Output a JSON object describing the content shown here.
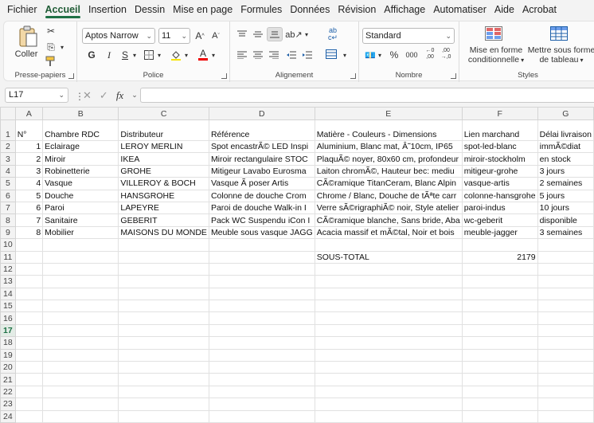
{
  "menu": [
    "Fichier",
    "Accueil",
    "Insertion",
    "Dessin",
    "Mise en page",
    "Formules",
    "Données",
    "Révision",
    "Affichage",
    "Automatiser",
    "Aide",
    "Acrobat"
  ],
  "active_menu_index": 1,
  "ribbon": {
    "clipboard": {
      "paste_label": "Coller",
      "group_label": "Presse-papiers"
    },
    "font": {
      "font_name": "Aptos Narrow",
      "font_size": "11",
      "group_label": "Police",
      "bold": "G",
      "italic": "I",
      "underline": "S"
    },
    "alignment": {
      "group_label": "Alignement"
    },
    "number": {
      "format": "Standard",
      "group_label": "Nombre"
    },
    "styles": {
      "conditional_label_1": "Mise en forme",
      "conditional_label_2": "conditionnelle",
      "table_label_1": "Mettre sous forme",
      "table_label_2": "de tableau",
      "group_label": "Styles"
    }
  },
  "formula_bar": {
    "name_box": "L17",
    "fx": "fx",
    "formula": ""
  },
  "columns": [
    "A",
    "B",
    "C",
    "D",
    "E",
    "F",
    "G"
  ],
  "rows": [
    {
      "n": "1",
      "cells": [
        "N°",
        "Chambre RDC",
        "Distributeur",
        "Référence",
        "Matière - Couleurs - Dimensions",
        "Lien marchand",
        "Délai livraison"
      ]
    },
    {
      "n": "2",
      "cells": [
        "1",
        "Eclairage",
        "LEROY MERLIN",
        "Spot encastrÃ© LED Inspi",
        "Aluminium, Blanc mat, Â˜10cm, IP65",
        "spot-led-blanc",
        "immÃ©diat"
      ]
    },
    {
      "n": "3",
      "cells": [
        "2",
        "Miroir",
        "IKEA",
        "Miroir rectangulaire STOC",
        "PlaquÃ© noyer, 80x60 cm, profondeur",
        "miroir-stockholm",
        "en stock"
      ]
    },
    {
      "n": "4",
      "cells": [
        "3",
        "Robinetterie",
        "GROHE",
        "Mitigeur Lavabo Eurosma",
        "Laiton chromÃ©, Hauteur bec: mediu",
        "mitigeur-grohe",
        "3 jours"
      ]
    },
    {
      "n": "5",
      "cells": [
        "4",
        "Vasque",
        "VILLEROY & BOCH",
        "Vasque Ã  poser Artis",
        "CÃ©ramique TitanCeram, Blanc Alpin",
        "vasque-artis",
        "2 semaines"
      ]
    },
    {
      "n": "6",
      "cells": [
        "5",
        "Douche",
        "HANSGROHE",
        "Colonne de douche Crom",
        "Chrome / Blanc, Douche de tÃªte carr",
        "colonne-hansgrohe",
        "5 jours"
      ]
    },
    {
      "n": "7",
      "cells": [
        "6",
        "Paroi",
        "LAPEYRE",
        "Paroi de douche Walk-in I",
        "Verre sÃ©rigraphiÃ© noir, Style atelier",
        "paroi-indus",
        "10 jours"
      ]
    },
    {
      "n": "8",
      "cells": [
        "7",
        "Sanitaire",
        "GEBERIT",
        "Pack WC Suspendu iCon I",
        "CÃ©ramique blanche, Sans bride, Aba",
        "wc-geberit",
        "disponible"
      ]
    },
    {
      "n": "9",
      "cells": [
        "8",
        "Mobilier",
        "MAISONS DU MONDE",
        "Meuble sous vasque JAGG",
        "Acacia massif et mÃ©tal, Noir et bois",
        "meuble-jagger",
        "3 semaines"
      ]
    },
    {
      "n": "10",
      "cells": [
        "",
        "",
        "",
        "",
        "",
        "",
        ""
      ]
    },
    {
      "n": "11",
      "cells": [
        "",
        "",
        "",
        "",
        "SOUS-TOTAL",
        "2179",
        ""
      ]
    },
    {
      "n": "12",
      "cells": [
        "",
        "",
        "",
        "",
        "",
        "",
        ""
      ]
    },
    {
      "n": "13",
      "cells": [
        "",
        "",
        "",
        "",
        "",
        "",
        ""
      ]
    },
    {
      "n": "14",
      "cells": [
        "",
        "",
        "",
        "",
        "",
        "",
        ""
      ]
    },
    {
      "n": "15",
      "cells": [
        "",
        "",
        "",
        "",
        "",
        "",
        ""
      ]
    },
    {
      "n": "16",
      "cells": [
        "",
        "",
        "",
        "",
        "",
        "",
        ""
      ]
    },
    {
      "n": "17",
      "cells": [
        "",
        "",
        "",
        "",
        "",
        "",
        ""
      ]
    },
    {
      "n": "18",
      "cells": [
        "",
        "",
        "",
        "",
        "",
        "",
        ""
      ]
    },
    {
      "n": "19",
      "cells": [
        "",
        "",
        "",
        "",
        "",
        "",
        ""
      ]
    },
    {
      "n": "20",
      "cells": [
        "",
        "",
        "",
        "",
        "",
        "",
        ""
      ]
    },
    {
      "n": "21",
      "cells": [
        "",
        "",
        "",
        "",
        "",
        "",
        ""
      ]
    },
    {
      "n": "22",
      "cells": [
        "",
        "",
        "",
        "",
        "",
        "",
        ""
      ]
    },
    {
      "n": "23",
      "cells": [
        "",
        "",
        "",
        "",
        "",
        "",
        ""
      ]
    },
    {
      "n": "24",
      "cells": [
        "",
        "",
        "",
        "",
        "",
        "",
        ""
      ]
    }
  ],
  "active_row": "17",
  "colors": {
    "accent": "#1e7145",
    "grid_line": "#e1e1e1"
  }
}
